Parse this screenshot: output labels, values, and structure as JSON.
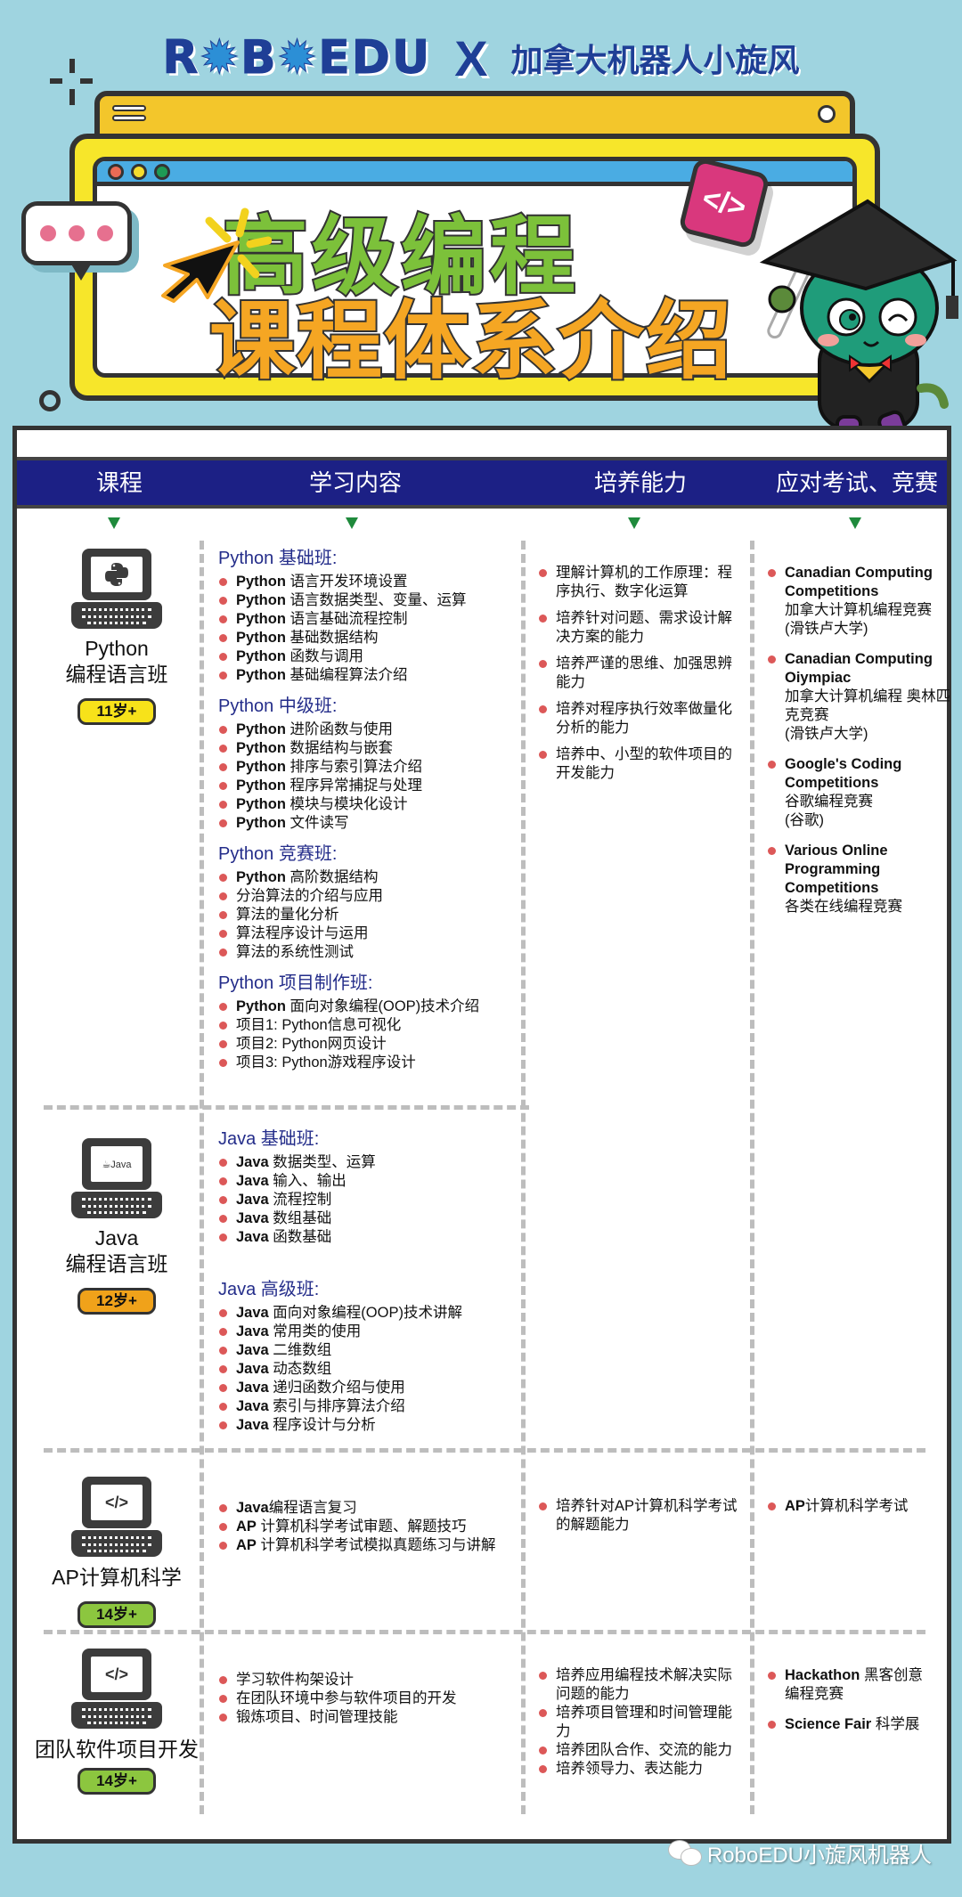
{
  "brand": {
    "logo": "ROBOEDU",
    "separator": "X",
    "partner": "加拿大机器人小旋风"
  },
  "hero": {
    "line1": "高级编程",
    "line2": "课程体系介绍",
    "code_tag": "</>"
  },
  "colors": {
    "background": "#9fd4e0",
    "header_bar": "#1c2085",
    "heading_text": "#242d8a",
    "bullet": "#dc5858",
    "arrow": "#1f8a3c",
    "badge_yellow": "#f7e21a",
    "badge_orange": "#f0a21a",
    "badge_green": "#8cc63f"
  },
  "table": {
    "headers": [
      "课程",
      "学习内容",
      "培养能力",
      "应对考试、竞赛"
    ],
    "rows": [
      {
        "icon": "python-logo",
        "course_en": "Python",
        "course_cn": "编程语言班",
        "age": "11岁+",
        "age_color": "yellow",
        "content": [
          {
            "heading": "Python 基础班:",
            "items": [
              [
                "Python",
                " 语言开发环境设置"
              ],
              [
                "Python",
                " 语言数据类型、变量、运算"
              ],
              [
                "Python",
                "  语言基础流程控制"
              ],
              [
                "Python",
                "  基础数据结构"
              ],
              [
                "Python",
                "  函数与调用"
              ],
              [
                "Python",
                "  基础编程算法介绍"
              ]
            ]
          },
          {
            "heading": "Python 中级班:",
            "items": [
              [
                "Python",
                " 进阶函数与使用"
              ],
              [
                "Python",
                " 数据结构与嵌套"
              ],
              [
                "Python",
                " 排序与索引算法介绍"
              ],
              [
                "Python",
                " 程序异常捕捉与处理"
              ],
              [
                "Python",
                " 模块与模块化设计"
              ],
              [
                "Python",
                " 文件读写"
              ]
            ]
          },
          {
            "heading": "Python 竞赛班:",
            "items": [
              [
                "Python",
                " 高阶数据结构"
              ],
              [
                "",
                "分治算法的介绍与应用"
              ],
              [
                "",
                "算法的量化分析"
              ],
              [
                "",
                "算法程序设计与运用"
              ],
              [
                "",
                "算法的系统性测试"
              ]
            ]
          },
          {
            "heading": "Python 项目制作班:",
            "items": [
              [
                "Python",
                " 面向对象编程(OOP)技术介绍"
              ],
              [
                "",
                "项目1:  Python信息可视化"
              ],
              [
                "",
                "项目2:  Python网页设计"
              ],
              [
                "",
                "项目3:  Python游戏程序设计"
              ]
            ]
          }
        ],
        "abilities": [
          "理解计算机的工作原理：程序执行、数字化运算",
          "培养针对问题、需求设计解决方案的能力",
          "培养严谨的思维、加强思辨能力",
          "培养对程序执行效率做量化分析的能力",
          "培养中、小型的软件项目的开发能力"
        ],
        "competitions": [
          {
            "en": "Canadian Computing Competitions",
            "cn": "加拿大计算机编程竞赛",
            "org": "(滑铁卢大学)"
          },
          {
            "en": "Canadian Computing Oiympiac",
            "cn": "加拿大计算机编程 奥林匹克竞赛",
            "org": "(滑铁卢大学)"
          },
          {
            "en": "Google's Coding Competitions",
            "cn": "谷歌编程竞赛",
            "org": "(谷歌)"
          },
          {
            "en": "Various Online Programming Competitions",
            "cn": "各类在线编程竞赛",
            "org": ""
          }
        ]
      },
      {
        "icon": "java-logo",
        "course_en": "Java",
        "course_cn": "编程语言班",
        "age": "12岁+",
        "age_color": "orange",
        "content": [
          {
            "heading": "Java 基础班:",
            "items": [
              [
                "Java",
                " 数据类型、运算"
              ],
              [
                "Java",
                " 输入、输出"
              ],
              [
                "Java",
                " 流程控制"
              ],
              [
                "Java",
                " 数组基础"
              ],
              [
                "Java",
                " 函数基础"
              ]
            ]
          },
          {
            "heading": "Java 高级班:",
            "items": [
              [
                "Java",
                " 面向对象编程(OOP)技术讲解"
              ],
              [
                "Java",
                " 常用类的使用"
              ],
              [
                "Java",
                " 二维数组"
              ],
              [
                "Java",
                " 动态数组"
              ],
              [
                "Java",
                " 递归函数介绍与使用"
              ],
              [
                "Java",
                " 索引与排序算法介绍"
              ],
              [
                "Java",
                " 程序设计与分析"
              ]
            ]
          }
        ],
        "abilities": [],
        "competitions": []
      },
      {
        "icon": "code-tag",
        "course_en": "",
        "course_cn": "AP计算机科学",
        "age": "14岁+",
        "age_color": "green",
        "content": [
          {
            "heading": "",
            "items": [
              [
                "Java",
                "编程语言复习"
              ],
              [
                "AP",
                " 计算机科学考试审题、解题技巧"
              ],
              [
                "AP",
                " 计算机科学考试模拟真题练习与讲解"
              ]
            ]
          }
        ],
        "abilities": [
          "培养针对AP计算机科学考试的解题能力"
        ],
        "competitions": [
          {
            "en": "AP",
            "cn": "计算机科学考试",
            "org": ""
          }
        ]
      },
      {
        "icon": "code-tag",
        "course_en": "",
        "course_cn": "团队软件项目开发",
        "age": "14岁+",
        "age_color": "green",
        "content": [
          {
            "heading": "",
            "items": [
              [
                "",
                "学习软件构架设计"
              ],
              [
                "",
                "在团队环境中参与软件项目的开发"
              ],
              [
                "",
                "锻炼项目、时间管理技能"
              ]
            ]
          }
        ],
        "abilities": [
          "培养应用编程技术解决实际问题的能力",
          "培养项目管理和时间管理能力",
          "培养团队合作、交流的能力",
          "培养领导力、表达能力"
        ],
        "competitions": [
          {
            "en": "Hackathon",
            "cn": " 黑客创意编程竞赛",
            "org": ""
          },
          {
            "en": "Science Fair",
            "cn": " 科学展",
            "org": ""
          }
        ]
      }
    ]
  },
  "watermark": "RoboEDU小旋风机器人"
}
